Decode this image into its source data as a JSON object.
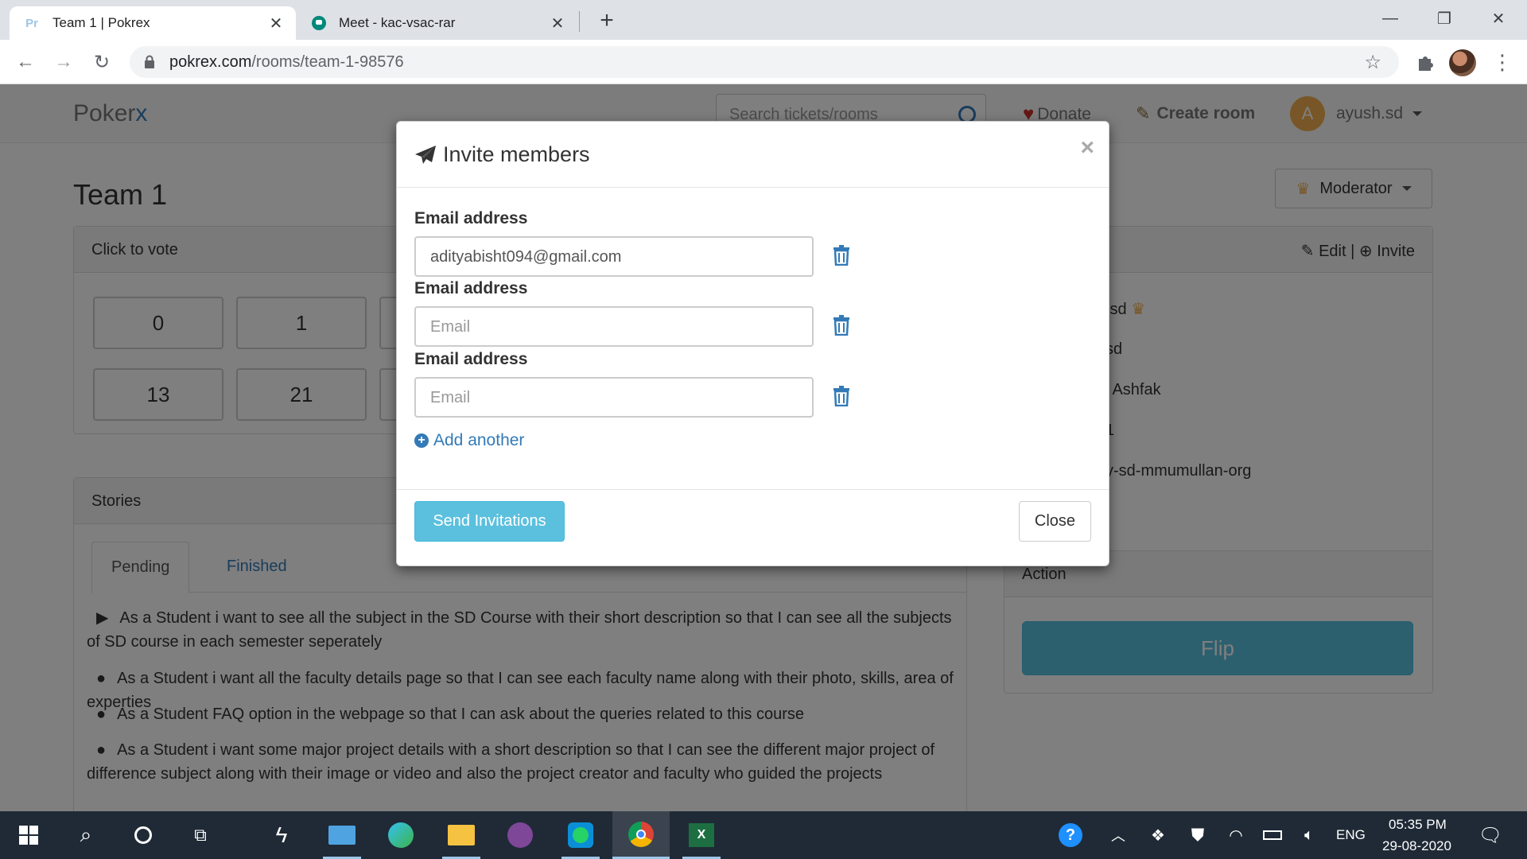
{
  "browser": {
    "tabs": [
      {
        "title": "Team 1 | Pokrex",
        "favicon": "pokrex-favicon-icon",
        "active": true
      },
      {
        "title": "Meet - kac-vsac-rar",
        "favicon": "google-meet-icon",
        "active": false
      }
    ],
    "url_domain": "pokrex.com",
    "url_path": "/rooms/team-1-98576"
  },
  "app": {
    "brand_prefix": "Poker",
    "brand_suffix": "x",
    "search_placeholder": "Search tickets/rooms",
    "donate_label": "Donate",
    "create_room_label": "Create room",
    "user_initial": "A",
    "user_name": "ayush.sd"
  },
  "room": {
    "title": "Team 1",
    "role": "Moderator",
    "vote_heading": "Click to vote",
    "cards": [
      "0",
      "1",
      "13",
      "21"
    ],
    "members_links": {
      "edit": "Edit",
      "separator": "|",
      "invite": "Invite"
    },
    "members": [
      ".sd",
      "sd",
      "k Ashfak",
      "1",
      "y-sd-mmumullan-org"
    ],
    "stories_heading": "Stories",
    "story_tabs": {
      "pending": "Pending",
      "finished": "Finished"
    },
    "stories": [
      "As a Student i want to see all the subject in the SD Course with their short description so that I can see all the subjects of SD course in each semester seperately",
      "As a Student i want all the faculty details page so that I can see each faculty name along with their photo, skills, area of experties",
      "As a Student FAQ option in the webpage so that I can ask about the queries related to this course",
      "As a Student i want some major project details with a short description so that I can see the different major project of difference subject along with their image or video and also the project creator and faculty who guided the projects"
    ],
    "action_heading": "Action",
    "flip_label": "Flip"
  },
  "modal": {
    "title": "Invite members",
    "close_symbol": "×",
    "email_label": "Email address",
    "email_placeholder": "Email",
    "emails": [
      "adityabisht094@gmail.com",
      "",
      ""
    ],
    "add_another_label": "Add another",
    "send_label": "Send Invitations",
    "close_label": "Close"
  },
  "taskbar": {
    "lang": "ENG",
    "time": "05:35 PM",
    "date": "29-08-2020"
  },
  "colors": {
    "primary_link": "#337ab7",
    "info_button": "#5bc0de",
    "taskbar": "#1f2a36"
  }
}
